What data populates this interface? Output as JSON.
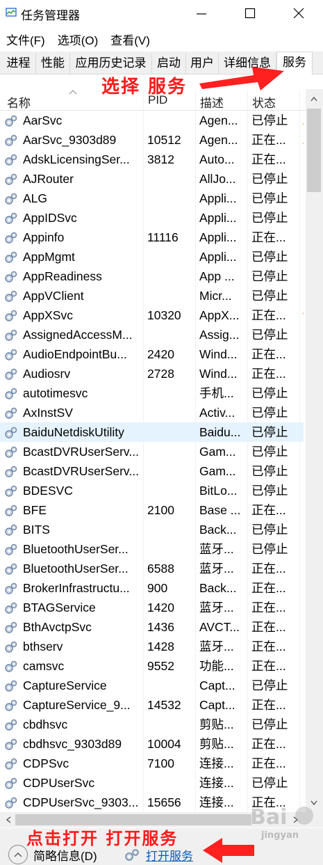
{
  "window": {
    "title": "任务管理器",
    "minimize_icon": "minimize-icon",
    "maximize_icon": "maximize-icon",
    "close_icon": "close-icon"
  },
  "menu": [
    "文件(F)",
    "选项(O)",
    "查看(V)"
  ],
  "tabs": [
    "进程",
    "性能",
    "应用历史记录",
    "启动",
    "用户",
    "详细信息",
    "服务"
  ],
  "active_tab": "服务",
  "columns": {
    "name": "名称",
    "pid": "PID",
    "desc": "描述",
    "status": "状态"
  },
  "sort_indicator": "name-ascending",
  "services": [
    {
      "name": "AarSvc",
      "pid": "",
      "desc": "Agen...",
      "status": "已停止",
      "extra": "A"
    },
    {
      "name": "AarSvc_9303d89",
      "pid": "10512",
      "desc": "Agen...",
      "status": "正在...",
      "extra": "A"
    },
    {
      "name": "AdskLicensingSer...",
      "pid": "3812",
      "desc": "Auto...",
      "status": "正在...",
      "extra": ""
    },
    {
      "name": "AJRouter",
      "pid": "",
      "desc": "AllJo...",
      "status": "已停止",
      "extra": ""
    },
    {
      "name": "ALG",
      "pid": "",
      "desc": "Appli...",
      "status": "已停止",
      "extra": ""
    },
    {
      "name": "AppIDSvc",
      "pid": "",
      "desc": "Appli...",
      "status": "已停止",
      "extra": ""
    },
    {
      "name": "Appinfo",
      "pid": "11116",
      "desc": "Appli...",
      "status": "正在...",
      "extra": ""
    },
    {
      "name": "AppMgmt",
      "pid": "",
      "desc": "Appli...",
      "status": "已停止",
      "extra": ""
    },
    {
      "name": "AppReadiness",
      "pid": "",
      "desc": "App ...",
      "status": "已停止",
      "extra": ""
    },
    {
      "name": "AppVClient",
      "pid": "",
      "desc": "Micr...",
      "status": "已停止",
      "extra": ""
    },
    {
      "name": "AppXSvc",
      "pid": "10320",
      "desc": "AppX...",
      "status": "正在...",
      "extra": "v"
    },
    {
      "name": "AssignedAccessM...",
      "pid": "",
      "desc": "Assig...",
      "status": "已停止",
      "extra": ""
    },
    {
      "name": "AudioEndpointBu...",
      "pid": "2420",
      "desc": "Wind...",
      "status": "正在...",
      "extra": ""
    },
    {
      "name": "Audiosrv",
      "pid": "2728",
      "desc": "Wind...",
      "status": "正在...",
      "extra": ""
    },
    {
      "name": "autotimesvc",
      "pid": "",
      "desc": "手机...",
      "status": "已停止",
      "extra": ""
    },
    {
      "name": "AxInstSV",
      "pid": "",
      "desc": "Activ...",
      "status": "已停止",
      "extra": ""
    },
    {
      "name": "BaiduNetdiskUtility",
      "pid": "",
      "desc": "Baidu...",
      "status": "已停止",
      "extra": "",
      "selected": true
    },
    {
      "name": "BcastDVRUserServ...",
      "pid": "",
      "desc": "Gam...",
      "status": "已停止",
      "extra": ""
    },
    {
      "name": "BcastDVRUserServ...",
      "pid": "",
      "desc": "Gam...",
      "status": "已停止",
      "extra": ""
    },
    {
      "name": "BDESVC",
      "pid": "",
      "desc": "BitLo...",
      "status": "已停止",
      "extra": ""
    },
    {
      "name": "BFE",
      "pid": "2100",
      "desc": "Base ...",
      "status": "正在...",
      "extra": ""
    },
    {
      "name": "BITS",
      "pid": "",
      "desc": "Back...",
      "status": "已停止",
      "extra": ""
    },
    {
      "name": "BluetoothUserSer...",
      "pid": "",
      "desc": "蓝牙...",
      "status": "已停止",
      "extra": ""
    },
    {
      "name": "BluetoothUserSer...",
      "pid": "6588",
      "desc": "蓝牙...",
      "status": "正在...",
      "extra": ""
    },
    {
      "name": "BrokerInfrastructu...",
      "pid": "900",
      "desc": "Back...",
      "status": "正在...",
      "extra": ""
    },
    {
      "name": "BTAGService",
      "pid": "1420",
      "desc": "蓝牙...",
      "status": "正在...",
      "extra": ""
    },
    {
      "name": "BthAvctpSvc",
      "pid": "1436",
      "desc": "AVCT...",
      "status": "正在...",
      "extra": ""
    },
    {
      "name": "bthserv",
      "pid": "1428",
      "desc": "蓝牙...",
      "status": "正在...",
      "extra": ""
    },
    {
      "name": "camsvc",
      "pid": "9552",
      "desc": "功能...",
      "status": "正在...",
      "extra": ""
    },
    {
      "name": "CaptureService",
      "pid": "",
      "desc": "Capt...",
      "status": "已停止",
      "extra": ""
    },
    {
      "name": "CaptureService_9...",
      "pid": "14532",
      "desc": "Capt...",
      "status": "正在...",
      "extra": ""
    },
    {
      "name": "cbdhsvc",
      "pid": "",
      "desc": "剪贴...",
      "status": "已停止",
      "extra": ""
    },
    {
      "name": "cbdhsvc_9303d89",
      "pid": "10004",
      "desc": "剪贴...",
      "status": "正在...",
      "extra": ""
    },
    {
      "name": "CDPSvc",
      "pid": "7100",
      "desc": "连接...",
      "status": "正在...",
      "extra": ""
    },
    {
      "name": "CDPUserSvc",
      "pid": "",
      "desc": "连接...",
      "status": "已停止",
      "extra": ""
    },
    {
      "name": "CDPUserSvc_9303...",
      "pid": "15656",
      "desc": "连接...",
      "status": "正在...",
      "extra": ""
    }
  ],
  "footer": {
    "fewer_details": "简略信息(D)",
    "open_services": "打开服务"
  },
  "annotations": {
    "select_services": "选择 服务",
    "click_open": "点击打开  打开服务"
  },
  "watermark": "Baidu jingyan",
  "colors": {
    "annotation": "#ff1a1a",
    "link": "#0b5dbf",
    "selected_row": "#e5f3ff"
  }
}
